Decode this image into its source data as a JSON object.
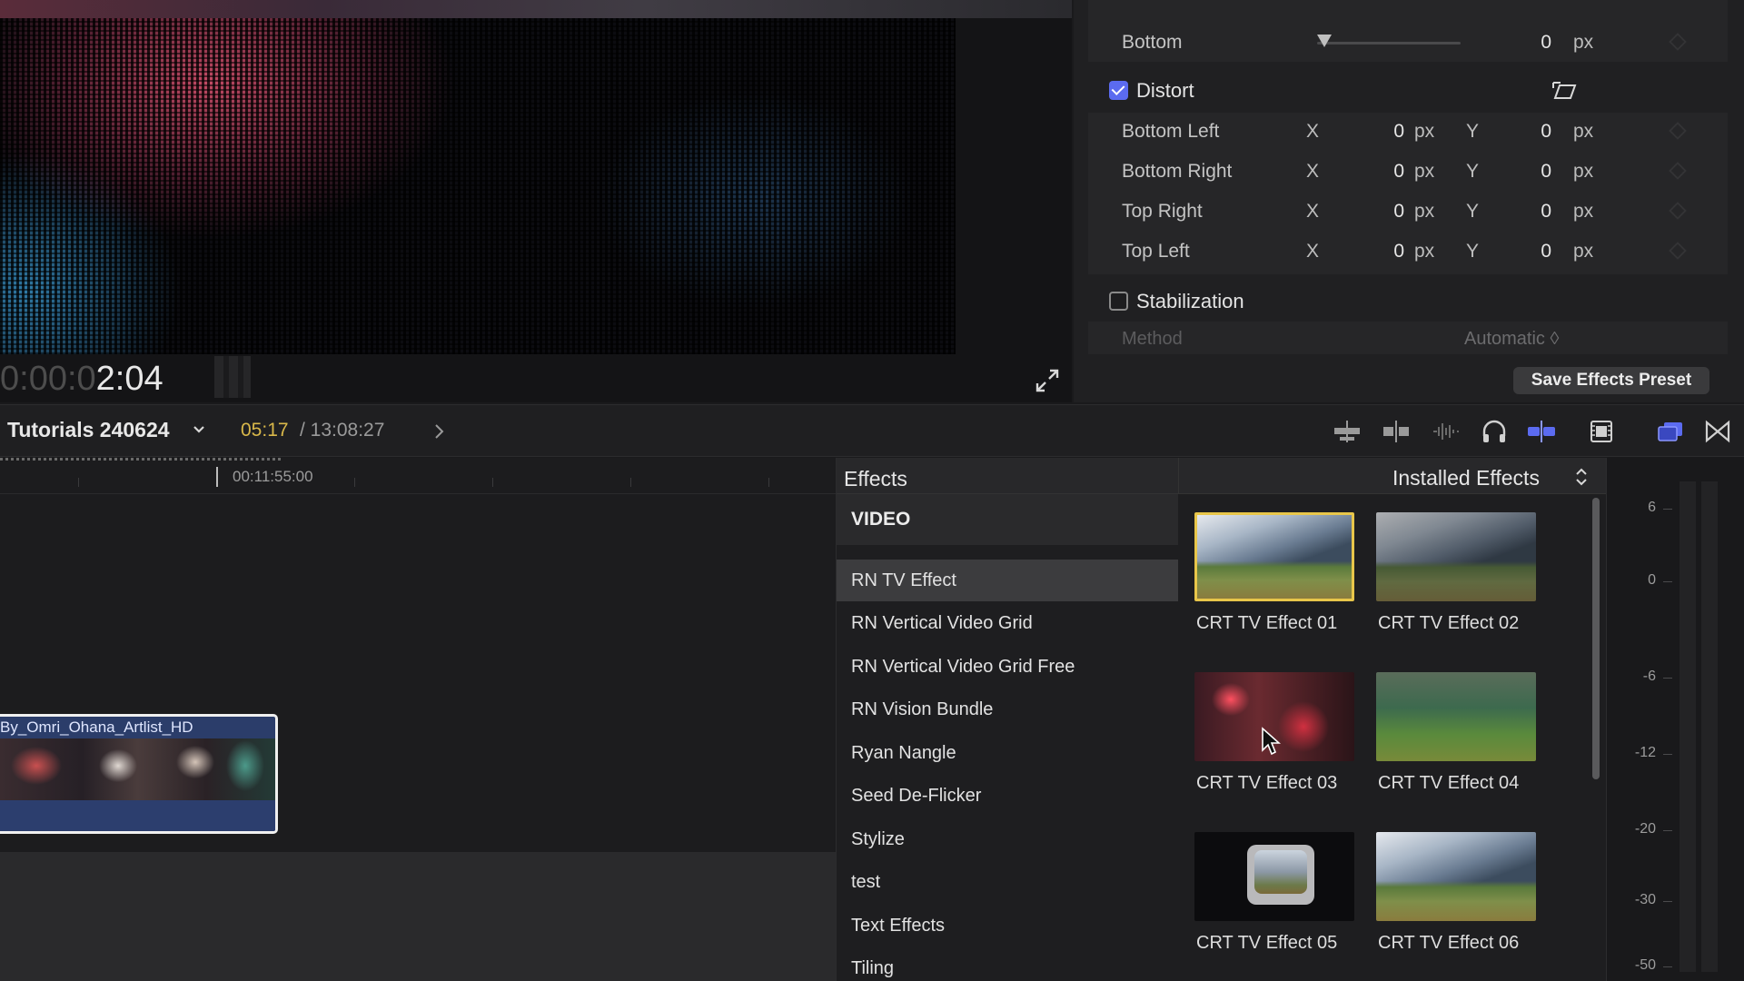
{
  "viewer": {
    "timecode_dim": "0:00:0",
    "timecode_bright": "2:04"
  },
  "inspector": {
    "bottom": {
      "label": "Bottom",
      "value": "0",
      "unit": "px"
    },
    "distort": {
      "label": "Distort",
      "checked": true,
      "rows": [
        {
          "label": "Bottom Left",
          "x_axis": "X",
          "x": "0",
          "x_unit": "px",
          "y_axis": "Y",
          "y": "0",
          "y_unit": "px"
        },
        {
          "label": "Bottom Right",
          "x_axis": "X",
          "x": "0",
          "x_unit": "px",
          "y_axis": "Y",
          "y": "0",
          "y_unit": "px"
        },
        {
          "label": "Top Right",
          "x_axis": "X",
          "x": "0",
          "x_unit": "px",
          "y_axis": "Y",
          "y": "0",
          "y_unit": "px"
        },
        {
          "label": "Top Left",
          "x_axis": "X",
          "x": "0",
          "x_unit": "px",
          "y_axis": "Y",
          "y": "0",
          "y_unit": "px"
        }
      ]
    },
    "stabilization": {
      "label": "Stabilization",
      "checked": false
    },
    "method": {
      "label": "Method",
      "value": "Automatic ◊"
    },
    "save_preset_label": "Save Effects Preset"
  },
  "toolbar": {
    "project_name": "Tutorials 240624",
    "timecode_current": "05:17",
    "timecode_total": "/ 13:08:27",
    "icons": [
      "clip-appearance-icon",
      "snapping-icon",
      "audio-skimming-icon",
      "solo-headphones-icon",
      "skimming-icon",
      "clip-filmstrip-icon",
      "effects-browser-icon",
      "transitions-icon"
    ]
  },
  "timeline": {
    "ruler_timecode": "00:11:55:00",
    "clip_name": "By_Omri_Ohana_Artlist_HD"
  },
  "effects": {
    "title": "Effects",
    "category_header": "VIDEO",
    "categories": [
      {
        "label": "RN TV Effect",
        "selected": true
      },
      {
        "label": "RN Vertical Video Grid",
        "selected": false
      },
      {
        "label": "RN Vertical Video Grid Free",
        "selected": false
      },
      {
        "label": "RN Vision Bundle",
        "selected": false
      },
      {
        "label": "Ryan Nangle",
        "selected": false
      },
      {
        "label": "Seed De-Flicker",
        "selected": false
      },
      {
        "label": "Stylize",
        "selected": false
      },
      {
        "label": "test",
        "selected": false
      },
      {
        "label": "Text Effects",
        "selected": false
      },
      {
        "label": "Tiling",
        "selected": false
      }
    ],
    "installed_label": "Installed Effects",
    "tiles": [
      {
        "name": "CRT TV Effect 01",
        "selected": true
      },
      {
        "name": "CRT TV Effect 02",
        "selected": false
      },
      {
        "name": "CRT TV Effect 03",
        "selected": false
      },
      {
        "name": "CRT TV Effect 04",
        "selected": false
      },
      {
        "name": "CRT TV Effect 05",
        "selected": false
      },
      {
        "name": "CRT TV Effect 06",
        "selected": false
      }
    ]
  },
  "meter": {
    "labels": [
      "6",
      "0",
      "-6",
      "-12",
      "-20",
      "-30",
      "-50"
    ]
  },
  "colors": {
    "accent_blue": "#5b6bf0",
    "selection_yellow": "#e8c64a",
    "timecode_gold": "#d9b84a",
    "clip_blue": "#2b3d6a"
  }
}
